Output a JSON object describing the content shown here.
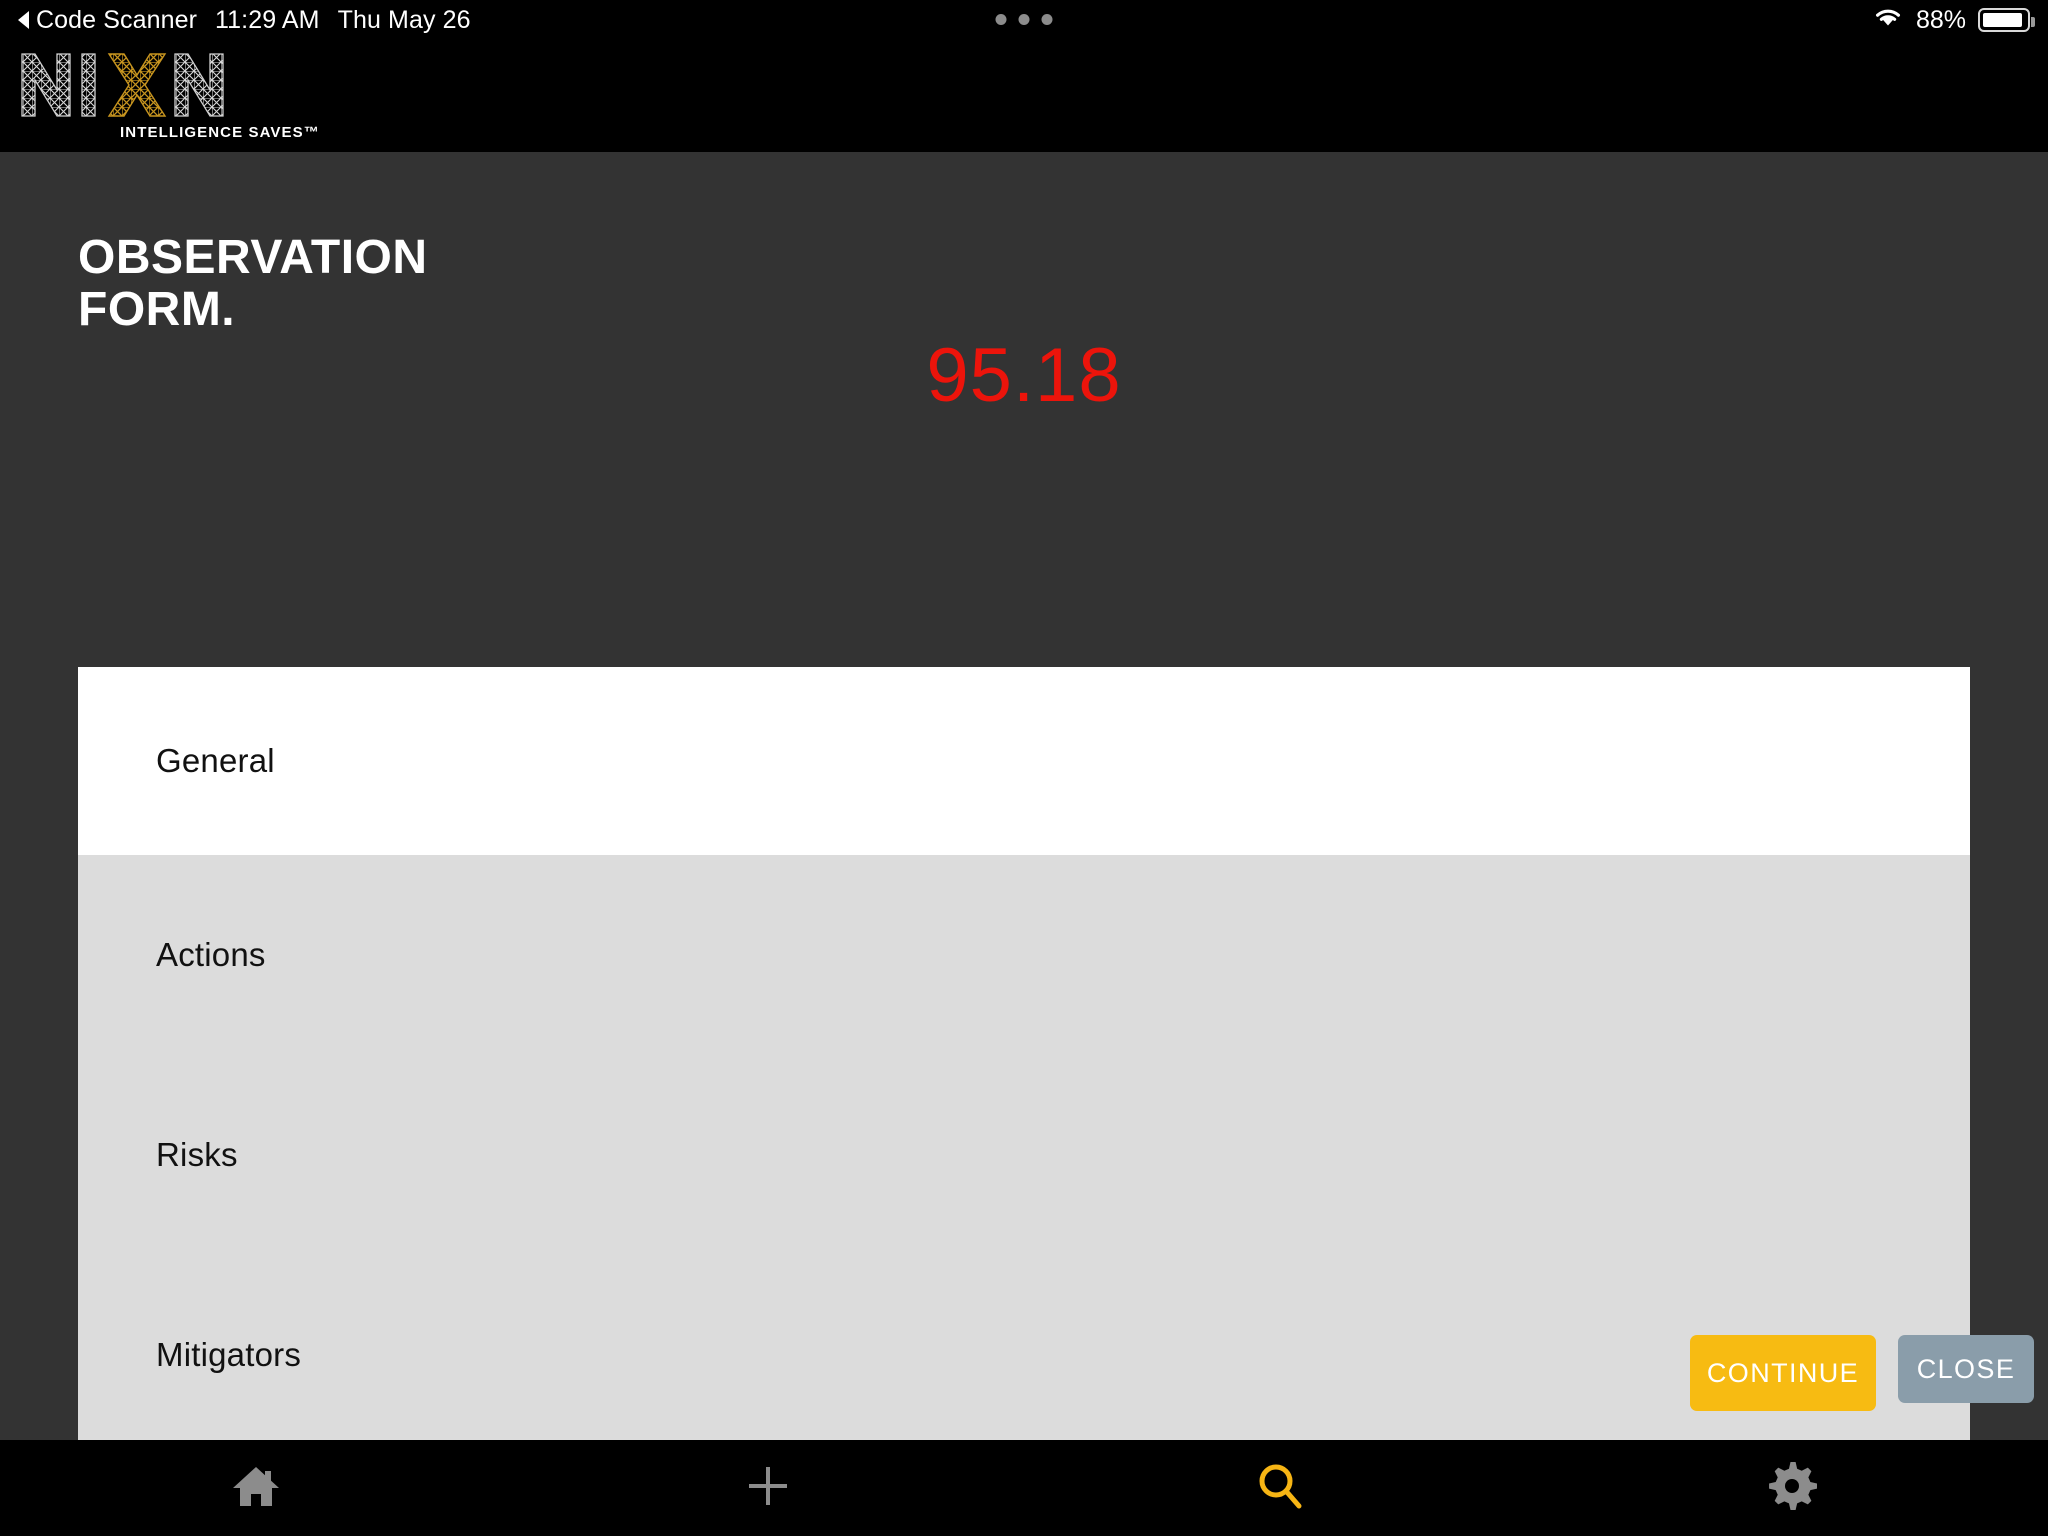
{
  "statusbar": {
    "back_icon": "triangle-left-icon",
    "back_app": "Code Scanner",
    "time": "11:29 AM",
    "date": "Thu May 26",
    "wifi_icon": "wifi-icon",
    "battery_percent": "88%",
    "battery_icon": "battery-icon",
    "multitask_dots": "handle-dots-icon"
  },
  "brand": {
    "logo_text": "NIXN",
    "logo_accent_letter": "X",
    "tagline": "INTELLIGENCE SAVES™",
    "accent_color": "#c8951f"
  },
  "header": {
    "title_line1": "OBSERVATION",
    "title_line2": "FORM.",
    "score": "95.18",
    "score_color": "#ec140b"
  },
  "list": {
    "items": [
      {
        "label": "General",
        "selected": true
      },
      {
        "label": "Actions",
        "selected": false
      },
      {
        "label": "Risks",
        "selected": false
      },
      {
        "label": "Mitigators",
        "selected": false
      }
    ]
  },
  "actions": {
    "continue_label": "CONTINUE",
    "continue_color": "#f7bb12",
    "close_label": "CLOSE",
    "close_color": "#8a9daa"
  },
  "tabbar": {
    "items": [
      {
        "icon": "home-icon",
        "active": false
      },
      {
        "icon": "plus-icon",
        "active": false
      },
      {
        "icon": "search-icon",
        "active": true
      },
      {
        "icon": "gear-icon",
        "active": false
      }
    ],
    "inactive_color": "#8c8c8c",
    "active_color": "#f7b514"
  }
}
